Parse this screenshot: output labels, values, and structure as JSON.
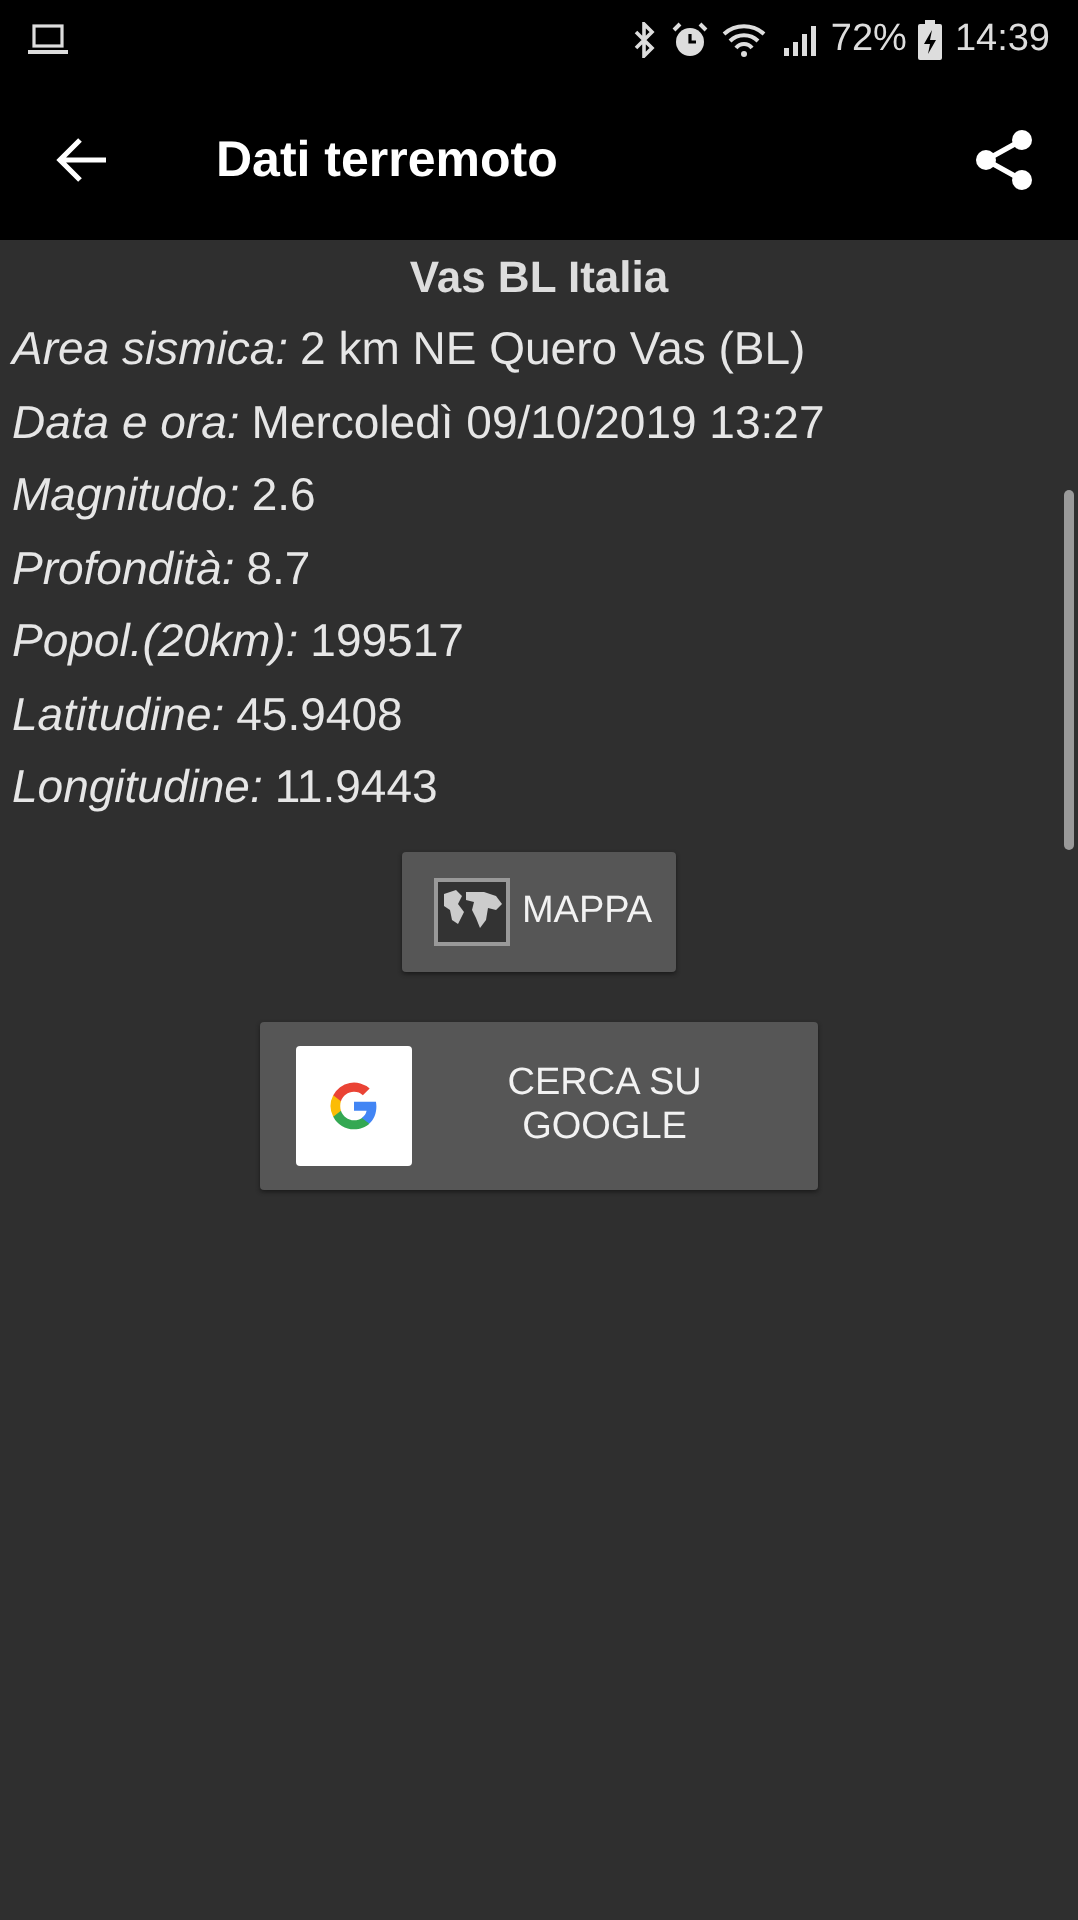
{
  "status_bar": {
    "battery": "72%",
    "time": "14:39"
  },
  "app_bar": {
    "title": "Dati terremoto"
  },
  "details": {
    "title": "Vas BL Italia",
    "fields": [
      {
        "label": "Area sismica:",
        "value": "2 km NE Quero Vas (BL)"
      },
      {
        "label": "Data e ora:",
        "value": "Mercoledì 09/10/2019 13:27"
      },
      {
        "label": "Magnitudo:",
        "value": "2.6"
      },
      {
        "label": "Profondità:",
        "value": "8.7"
      },
      {
        "label": "Popol.(20km):",
        "value": "199517"
      },
      {
        "label": "Latitudine:",
        "value": "45.9408"
      },
      {
        "label": "Longitudine:",
        "value": "11.9443"
      }
    ]
  },
  "buttons": [
    {
      "kind": "map",
      "label": "MAPPA"
    },
    {
      "kind": "google",
      "label": "CERCA SU GOOGLE"
    }
  ]
}
